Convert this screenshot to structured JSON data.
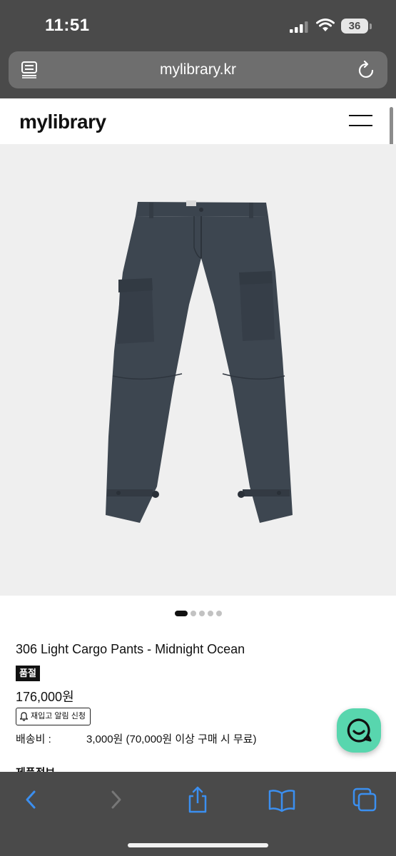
{
  "status_bar": {
    "time": "11:51",
    "battery_level": "36"
  },
  "browser": {
    "url": "mylibrary.kr"
  },
  "site": {
    "logo": "mylibrary"
  },
  "product": {
    "image_alt": "306 Light Cargo Pants - Midnight Ocean",
    "image_pagination": {
      "current": 1,
      "total": 5
    },
    "title": "306 Light Cargo Pants - Midnight Ocean",
    "badge": "품절",
    "price": "176,000원",
    "restock_button": "재입고 알림 신청",
    "shipping_label": "배송비 :",
    "shipping_value": "3,000원 (70,000원 이상 구매 시 무료)",
    "next_section": "제품정보"
  },
  "colors": {
    "chat_button": "#58d6ae",
    "toolbar_accent": "#3b8ff0",
    "pants": "#3d4650"
  },
  "icons": {
    "reader": "reader-mode-icon",
    "reload": "reload-icon",
    "menu": "hamburger-menu-icon",
    "chat": "chat-icon",
    "back": "back-icon",
    "forward": "forward-icon",
    "share": "share-icon",
    "bookmarks": "bookmarks-icon",
    "tabs": "tabs-icon"
  }
}
